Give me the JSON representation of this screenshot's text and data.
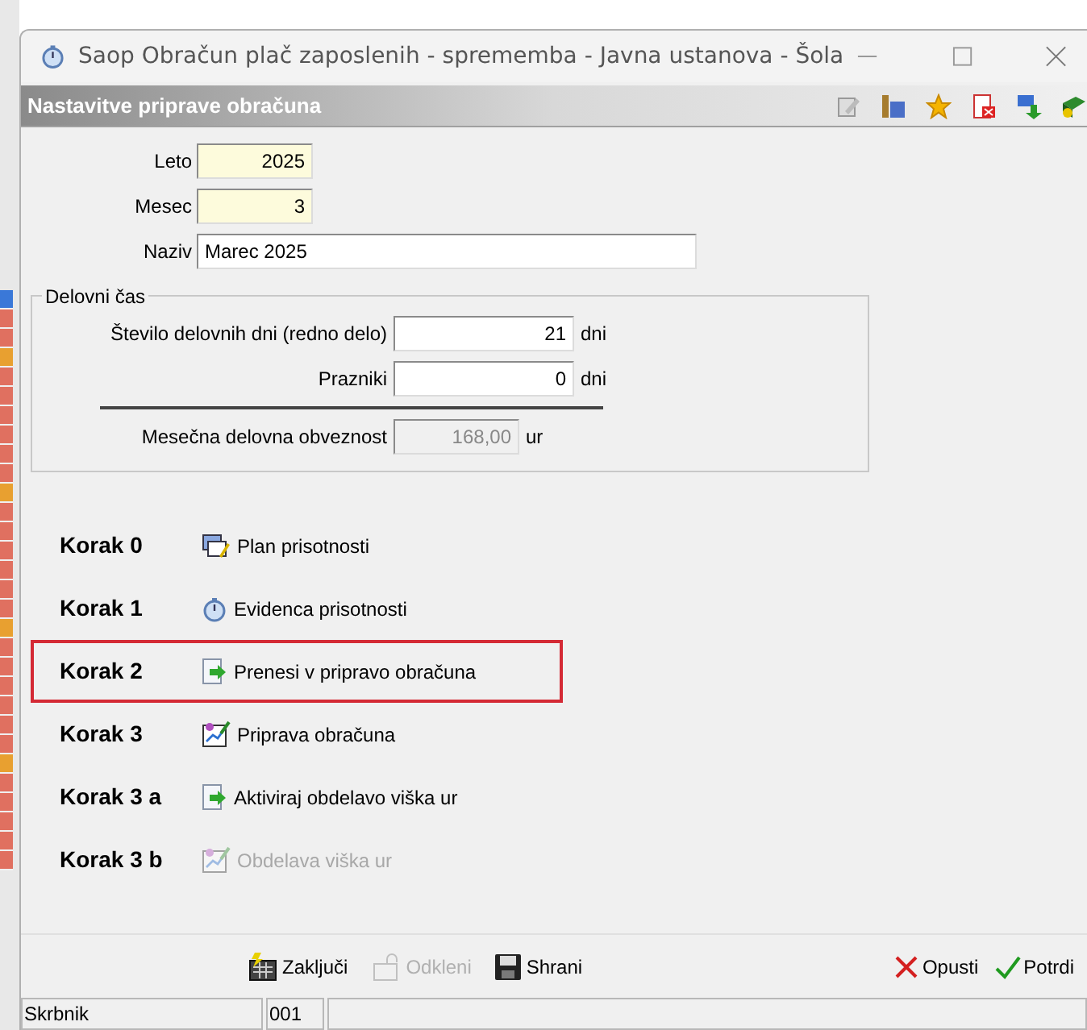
{
  "window": {
    "title": "Saop Obračun plač zaposlenih - sprememba - Javna ustanova - Šola"
  },
  "header": {
    "title": "Nastavitve priprave obračuna"
  },
  "fields": [
    {
      "label": "Leto",
      "value": "2025",
      "kind": "short"
    },
    {
      "label": "Mesec",
      "value": "3",
      "kind": "short"
    },
    {
      "label": "Naziv",
      "value": "Marec 2025",
      "kind": "wide"
    }
  ],
  "working_time": {
    "title": "Delovni čas",
    "rows": [
      {
        "label": "Število delovnih dni (redno delo)",
        "value": "21",
        "unit": "dni",
        "disabled": false
      },
      {
        "label": "Prazniki",
        "value": "0",
        "unit": "dni",
        "disabled": false
      }
    ],
    "total": {
      "label": "Mesečna delovna obveznost",
      "value": "168,00",
      "unit": "ur",
      "disabled": true
    }
  },
  "steps": [
    {
      "step": "Korak 0",
      "label": "Plan prisotnosti",
      "disabled": false,
      "highlighted": false
    },
    {
      "step": "Korak 1",
      "label": "Evidenca prisotnosti",
      "disabled": false,
      "highlighted": false
    },
    {
      "step": "Korak 2",
      "label": "Prenesi v pripravo obračuna",
      "disabled": false,
      "highlighted": true
    },
    {
      "step": "Korak 3",
      "label": "Priprava obračuna",
      "disabled": false,
      "highlighted": false
    },
    {
      "step": "Korak 3 a",
      "label": "Aktiviraj obdelavo viška ur",
      "disabled": false,
      "highlighted": false
    },
    {
      "step": "Korak 3 b",
      "label": "Obdelava viška ur",
      "disabled": true,
      "highlighted": false
    }
  ],
  "actions": [
    {
      "label": "Zaključi",
      "disabled": false
    },
    {
      "label": "Odkleni",
      "disabled": true
    },
    {
      "label": "Shrani",
      "disabled": false
    }
  ],
  "dialog_buttons": [
    "Opusti",
    "Potrdi"
  ],
  "status_bar": [
    "Skrbnik",
    "001"
  ]
}
